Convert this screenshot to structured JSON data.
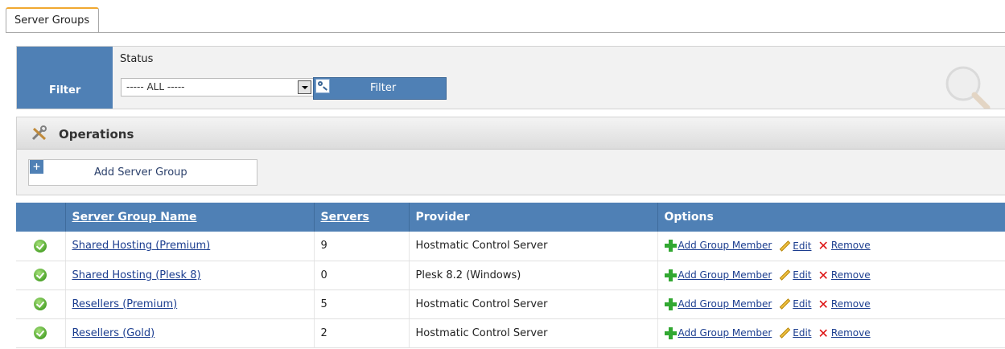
{
  "tabs": [
    {
      "label": "Server Groups"
    }
  ],
  "filter": {
    "label": "Filter",
    "status_label": "Status",
    "status_value": "----- ALL -----",
    "button_label": "Filter"
  },
  "operations": {
    "title": "Operations",
    "add_button_label": "Add Server Group"
  },
  "table": {
    "headers": {
      "name": "Server Group Name",
      "servers": "Servers",
      "provider": "Provider",
      "options": "Options"
    },
    "rows": [
      {
        "name": "Shared Hosting (Premium)",
        "servers": "9",
        "provider": "Hostmatic Control Server"
      },
      {
        "name": "Shared Hosting (Plesk 8)",
        "servers": "0",
        "provider": "Plesk 8.2 (Windows)"
      },
      {
        "name": "Resellers (Premium)",
        "servers": "5",
        "provider": "Hostmatic Control Server"
      },
      {
        "name": "Resellers (Gold)",
        "servers": "2",
        "provider": "Hostmatic Control Server"
      }
    ],
    "option_labels": {
      "add_member": "Add Group Member",
      "edit": "Edit",
      "remove": "Remove"
    }
  },
  "colors": {
    "accent_blue": "#4f80b5",
    "tab_highlight": "#f0a830",
    "status_ok": "#4fa52d",
    "remove_red": "#d11111"
  },
  "icons": [
    "magnifier-icon",
    "tools-icon",
    "plus-icon",
    "check-circle-icon",
    "add-member-icon",
    "pencil-icon",
    "remove-x-icon"
  ]
}
